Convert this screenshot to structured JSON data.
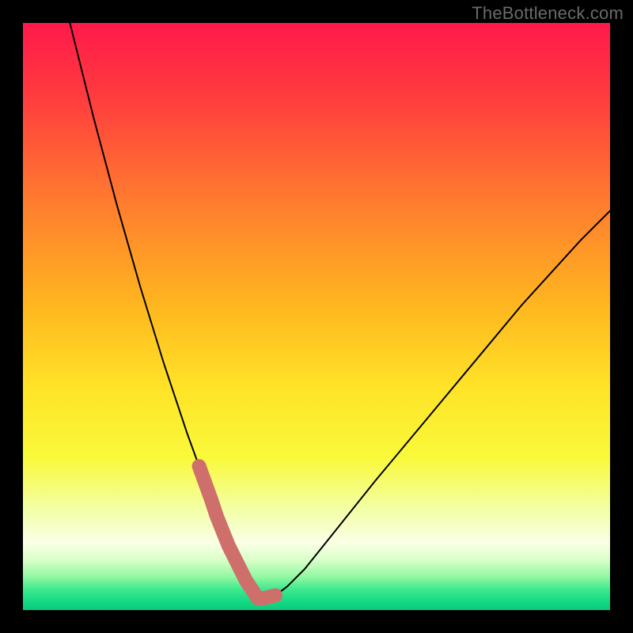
{
  "watermark": "TheBottleneck.com",
  "colors": {
    "frame": "#000000",
    "curve": "#000000",
    "highlight": "#cf6f6c",
    "gradient_stops": [
      {
        "offset": 0.0,
        "color": "#ff1a4b"
      },
      {
        "offset": 0.12,
        "color": "#ff3a3f"
      },
      {
        "offset": 0.3,
        "color": "#ff7a2f"
      },
      {
        "offset": 0.48,
        "color": "#ffb61f"
      },
      {
        "offset": 0.62,
        "color": "#ffe327"
      },
      {
        "offset": 0.74,
        "color": "#f9f93a"
      },
      {
        "offset": 0.83,
        "color": "#f3ffa8"
      },
      {
        "offset": 0.885,
        "color": "#fbffe6"
      },
      {
        "offset": 0.915,
        "color": "#d9ffc9"
      },
      {
        "offset": 0.945,
        "color": "#8cf7a0"
      },
      {
        "offset": 0.965,
        "color": "#3de98e"
      },
      {
        "offset": 0.985,
        "color": "#14da84"
      },
      {
        "offset": 1.0,
        "color": "#0cc97a"
      }
    ]
  },
  "chart_data": {
    "type": "line",
    "title": "",
    "xlabel": "",
    "ylabel": "",
    "xlim": [
      0,
      100
    ],
    "ylim": [
      0,
      100
    ],
    "grid": false,
    "series": [
      {
        "name": "curve",
        "x": [
          8,
          10,
          12,
          14,
          16,
          18,
          20,
          22,
          24,
          26,
          28,
          30,
          32,
          33,
          34,
          35,
          36,
          37,
          38,
          39,
          40,
          41,
          43,
          45,
          48,
          52,
          56,
          60,
          65,
          70,
          75,
          80,
          85,
          90,
          95,
          100
        ],
        "y": [
          100,
          92,
          84,
          76.5,
          69,
          62,
          55,
          48.5,
          42,
          36,
          30,
          24.5,
          19,
          16,
          13.5,
          11,
          9,
          7,
          5,
          3.5,
          2,
          2,
          2.5,
          4,
          7,
          12,
          17,
          22,
          28,
          34,
          40,
          46,
          52,
          57.5,
          63,
          68
        ]
      }
    ],
    "annotations": [
      {
        "name": "highlight-band",
        "x_range": [
          30,
          44
        ],
        "note": "thick salmon segment over curve near minimum"
      }
    ]
  }
}
